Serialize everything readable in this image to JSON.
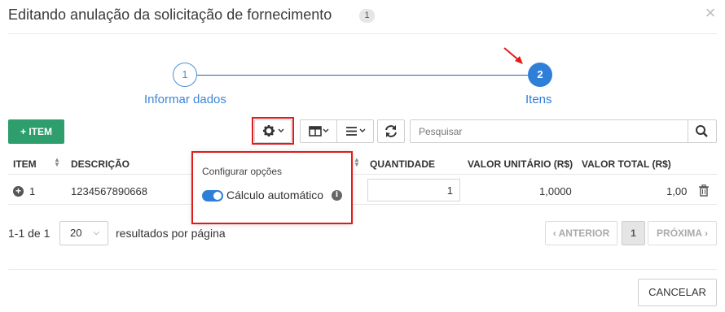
{
  "modal": {
    "title": "Editando anulação da solicitação de fornecimento",
    "badge": "1",
    "close_label": "×"
  },
  "stepper": {
    "steps": [
      {
        "number": "1",
        "label": "Informar dados",
        "active": false
      },
      {
        "number": "2",
        "label": "Itens",
        "active": true
      }
    ]
  },
  "toolbar": {
    "add_label": "+ ITEM",
    "search_placeholder": "Pesquisar",
    "icons": [
      "gear-icon",
      "columns-icon",
      "list-icon",
      "refresh-icon",
      "search-icon"
    ]
  },
  "table": {
    "columns": [
      "ITEM",
      "DESCRIÇÃO",
      "QUANTIDADE",
      "VALOR UNITÁRIO (R$)",
      "VALOR TOTAL (R$)"
    ],
    "rows": [
      {
        "item": "1",
        "descricao": "1234567890668",
        "quantidade": "1",
        "valor_unitario": "1,0000",
        "valor_total": "1,00"
      }
    ]
  },
  "settings_popover": {
    "title": "Configurar opções",
    "toggle_label": "Cálculo automático",
    "toggle_on": true
  },
  "pagination": {
    "range": "1-1 de 1",
    "page_size": "20",
    "per_page_label": "resultados por página",
    "prev_label": "ANTERIOR",
    "current_page": "1",
    "next_label": "PRÓXIMA"
  },
  "footer": {
    "cancel_label": "CANCELAR"
  },
  "colors": {
    "primary": "#2f7fd8",
    "success": "#2e9f6c",
    "annotation": "#e11b1b"
  }
}
